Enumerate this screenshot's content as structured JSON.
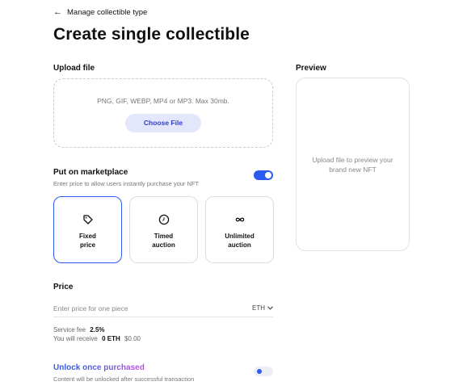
{
  "nav": {
    "back_label": "Manage collectible type"
  },
  "page": {
    "title": "Create single collectible"
  },
  "upload": {
    "label": "Upload file",
    "hint": "PNG, GIF, WEBP, MP4 or MP3. Max 30mb.",
    "button_label": "Choose File"
  },
  "preview": {
    "label": "Preview",
    "placeholder": "Upload file to preview your brand new NFT"
  },
  "marketplace": {
    "label": "Put on marketplace",
    "description": "Enter price to allow users instantly purchase your NFT",
    "toggle_on": true,
    "options": [
      {
        "line1": "Fixed",
        "line2": "price",
        "icon": "tag-icon",
        "selected": true
      },
      {
        "line1": "Timed",
        "line2": "auction",
        "icon": "clock-icon",
        "selected": false
      },
      {
        "line1": "Unlimited",
        "line2": "auction",
        "icon": "infinity-icon",
        "selected": false
      }
    ]
  },
  "price": {
    "label": "Price",
    "placeholder": "Enter price for one piece",
    "currency": "ETH",
    "service_fee_label": "Service fee",
    "service_fee_value": "2.5%",
    "receive_label": "You will receive",
    "receive_value": "0 ETH",
    "receive_usd": "$0.00"
  },
  "unlock": {
    "label_plain": "Unlock ",
    "label_gradient": "once purchased",
    "description": "Content will be unlocked after successful transaction",
    "toggle_on": false
  },
  "colors": {
    "accent": "#2a5bf0",
    "button_bg": "#e4e7fb"
  }
}
